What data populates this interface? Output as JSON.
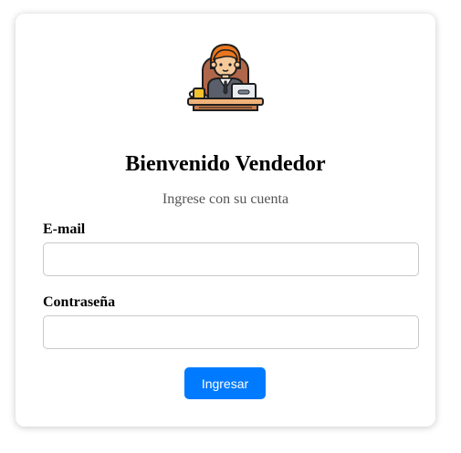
{
  "login": {
    "title": "Bienvenido Vendedor",
    "subtitle": "Ingrese con su cuenta",
    "email_label": "E-mail",
    "email_value": "",
    "password_label": "Contraseña",
    "password_value": "",
    "submit_label": "Ingresar",
    "avatar_icon": "seller-at-desk-icon"
  },
  "colors": {
    "accent": "#007bff",
    "subtitle_text": "#555555",
    "input_border": "#c8c8c8"
  }
}
